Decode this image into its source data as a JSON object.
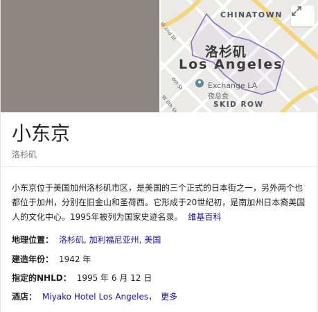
{
  "entity": {
    "title": "小东京",
    "subtitle": "洛杉矶"
  },
  "map": {
    "neighborhood_label": "CHINATOWN",
    "city_cn": "洛杉矶",
    "city_en": "Los Angeles",
    "poi_name": "Exchange LA",
    "poi_name_cn": "夜总会",
    "district_label": "SKID ROW",
    "street_w2nd": "W 2nd St",
    "street_6th": "6th St",
    "street_w8th": "W 8th St",
    "expand_icon": "expand-icon"
  },
  "description": {
    "text": "小东京位于美国加州洛杉矶市区，是美国的三个正式的日本街之一，另外两个也都位于加州，分别在旧金山和圣荷西。它形成于20世纪初，是南加州日本裔美国人的文化中心。1995年被列为国家史迹名录。",
    "source_link": "维基百科"
  },
  "facts": {
    "location_key": "地理位置：",
    "location_links": [
      "洛杉矶",
      "加利福尼亚州",
      "美国"
    ],
    "location_sep": ", ",
    "built_key": "建造年份：",
    "built_value": "1942 年",
    "nhld_key": "指定的NHLD：",
    "nhld_value": "1995 年 6 月 12 日",
    "hotel_key": "酒店：",
    "hotel_link": "Miyako Hotel Los Angeles",
    "hotel_sep": "，",
    "more_link": "更多"
  },
  "colors": {
    "link": "#1a0dab",
    "photo_placeholder": "#8d8580",
    "boundary": "#8e6fc1",
    "highway": "#f4d57a",
    "poi_pin": "#5f8a96"
  }
}
